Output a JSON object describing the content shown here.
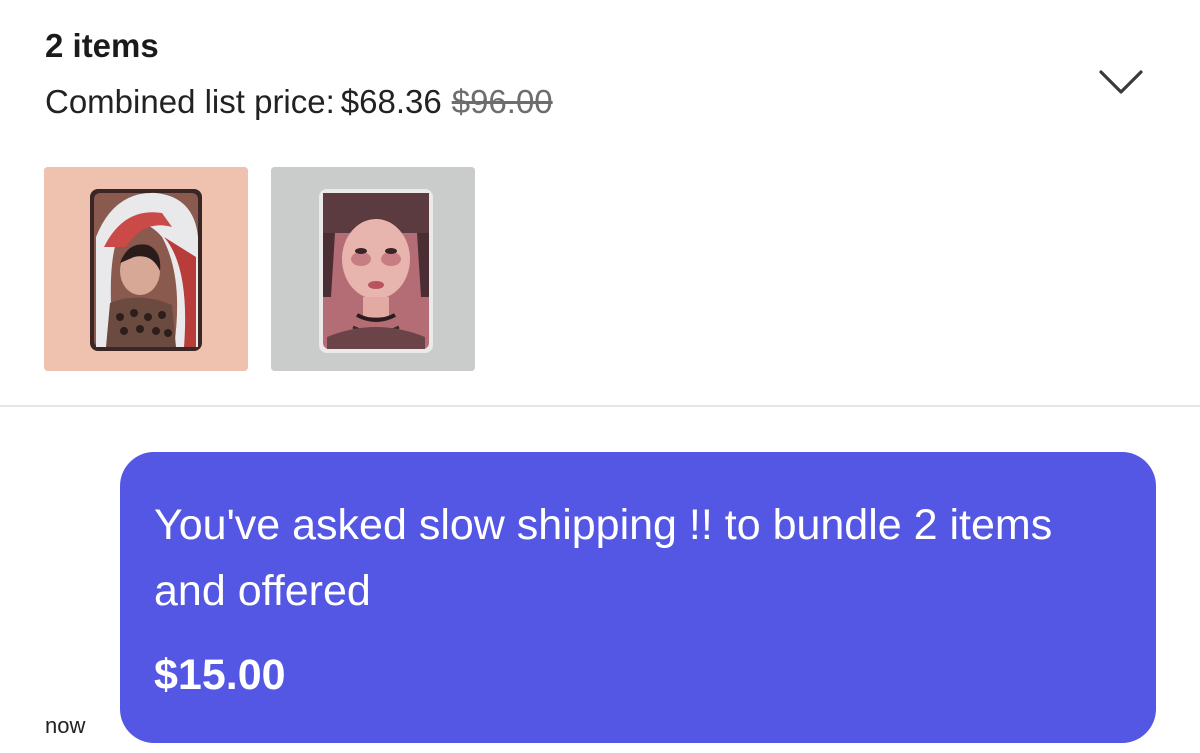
{
  "bundle": {
    "items_count": "2 items",
    "price_label": "Combined list price:",
    "current_price": "$68.36",
    "original_price": "$96.00",
    "expand_icon": "chevron-down-icon",
    "thumbnails": [
      {
        "icon": "photocard-image"
      },
      {
        "icon": "photocard-image"
      }
    ]
  },
  "message": {
    "text": "You've asked slow shipping !! to bundle 2 items and offered",
    "amount": "$15.00",
    "timestamp": "now"
  },
  "colors": {
    "bubble": "#5457e3",
    "divider": "#e5e5e5",
    "strike_price": "#6d6d6d"
  }
}
